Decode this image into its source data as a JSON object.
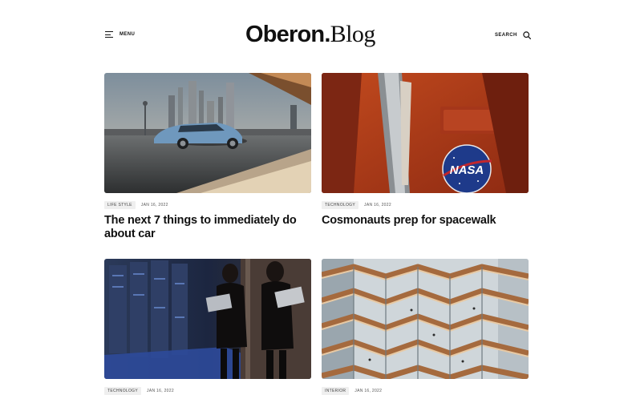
{
  "header": {
    "menu_label": "MENU",
    "logo_part1": "Oberon.",
    "logo_part2": "Blog",
    "search_label": "SEARCH"
  },
  "posts": [
    {
      "category": "LIFE STYLE",
      "date": "JAN 16, 2022",
      "title": "The next 7 things to immediately do about car"
    },
    {
      "category": "TECHNOLOGY",
      "date": "JAN 16, 2022",
      "title": "Cosmonauts prep for spacewalk"
    },
    {
      "category": "TECHNOLOGY",
      "date": "JAN 16, 2022",
      "title": ""
    },
    {
      "category": "INTERIOR",
      "date": "JAN 16, 2022",
      "title": ""
    }
  ],
  "nasa_patch_text": "NASA",
  "icons": {
    "menu": "hamburger-icon",
    "search": "search-icon"
  }
}
